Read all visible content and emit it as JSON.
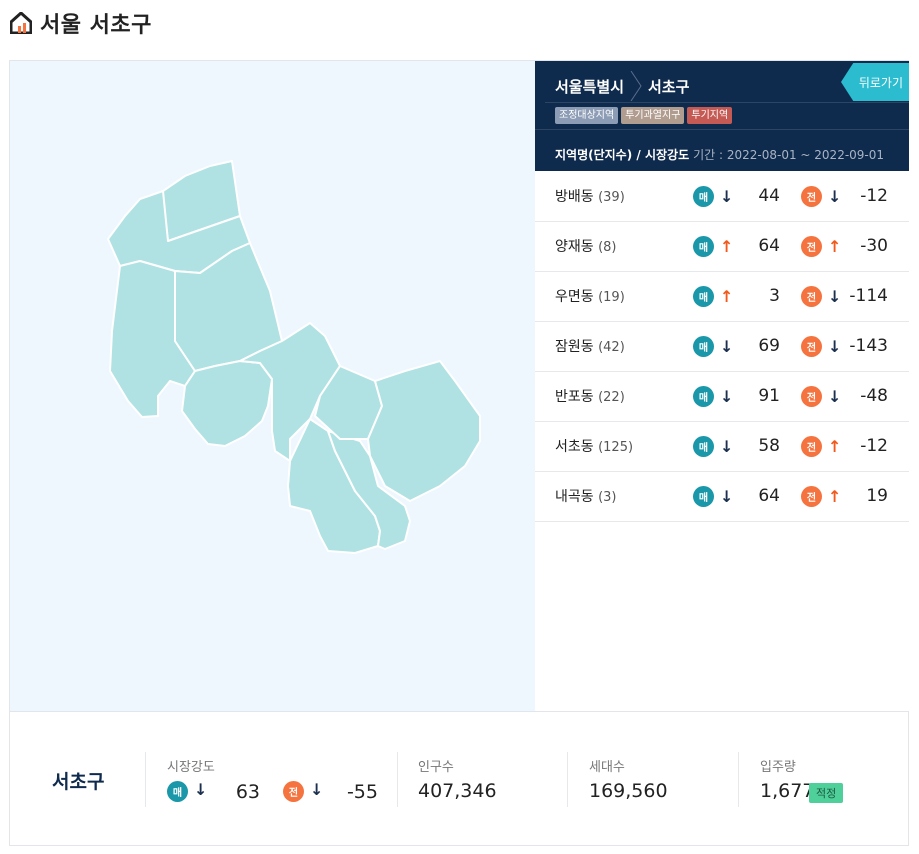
{
  "header": {
    "title": "서울 서초구",
    "icon": "home-chart-icon"
  },
  "breadcrumb": {
    "city": "서울특별시",
    "district": "서초구"
  },
  "back_button": "뒤로가기",
  "tags": [
    "조정대상지역",
    "투기과열지구",
    "투기지역"
  ],
  "period": {
    "label": "지역명(단지수) / 시장강도",
    "range": "기간 : 2022-08-01 ~ 2022-09-01"
  },
  "badges": {
    "maemae": "매",
    "jeonse": "전"
  },
  "rows": [
    {
      "name": "방배동",
      "count": "(39)",
      "m_dir": "down",
      "m_val": "44",
      "j_dir": "down",
      "j_val": "-12"
    },
    {
      "name": "양재동",
      "count": "(8)",
      "m_dir": "up",
      "m_val": "64",
      "j_dir": "up",
      "j_val": "-30"
    },
    {
      "name": "우면동",
      "count": "(19)",
      "m_dir": "up",
      "m_val": "3",
      "j_dir": "down",
      "j_val": "-114"
    },
    {
      "name": "잠원동",
      "count": "(42)",
      "m_dir": "down",
      "m_val": "69",
      "j_dir": "down",
      "j_val": "-143"
    },
    {
      "name": "반포동",
      "count": "(22)",
      "m_dir": "down",
      "m_val": "91",
      "j_dir": "down",
      "j_val": "-48"
    },
    {
      "name": "서초동",
      "count": "(125)",
      "m_dir": "down",
      "m_val": "58",
      "j_dir": "up",
      "j_val": "-12"
    },
    {
      "name": "내곡동",
      "count": "(3)",
      "m_dir": "down",
      "m_val": "64",
      "j_dir": "up",
      "j_val": "19"
    }
  ],
  "footer": {
    "name": "서초구",
    "market_label": "시장강도",
    "market_m_dir": "down",
    "market_m_val": "63",
    "market_j_dir": "down",
    "market_j_val": "-55",
    "population_label": "인구수",
    "population": "407,346",
    "households_label": "세대수",
    "households": "169,560",
    "supply_label": "입주량",
    "supply": "1,677",
    "supply_status": "적정"
  },
  "colors": {
    "map_fill": "#b0e2e3",
    "map_bg": "#eef6fe",
    "navy": "#0e2a4d",
    "teal": "#1a97a8",
    "orange": "#f5733f",
    "up": "#f25a1d",
    "down": "#1b2f4f"
  }
}
